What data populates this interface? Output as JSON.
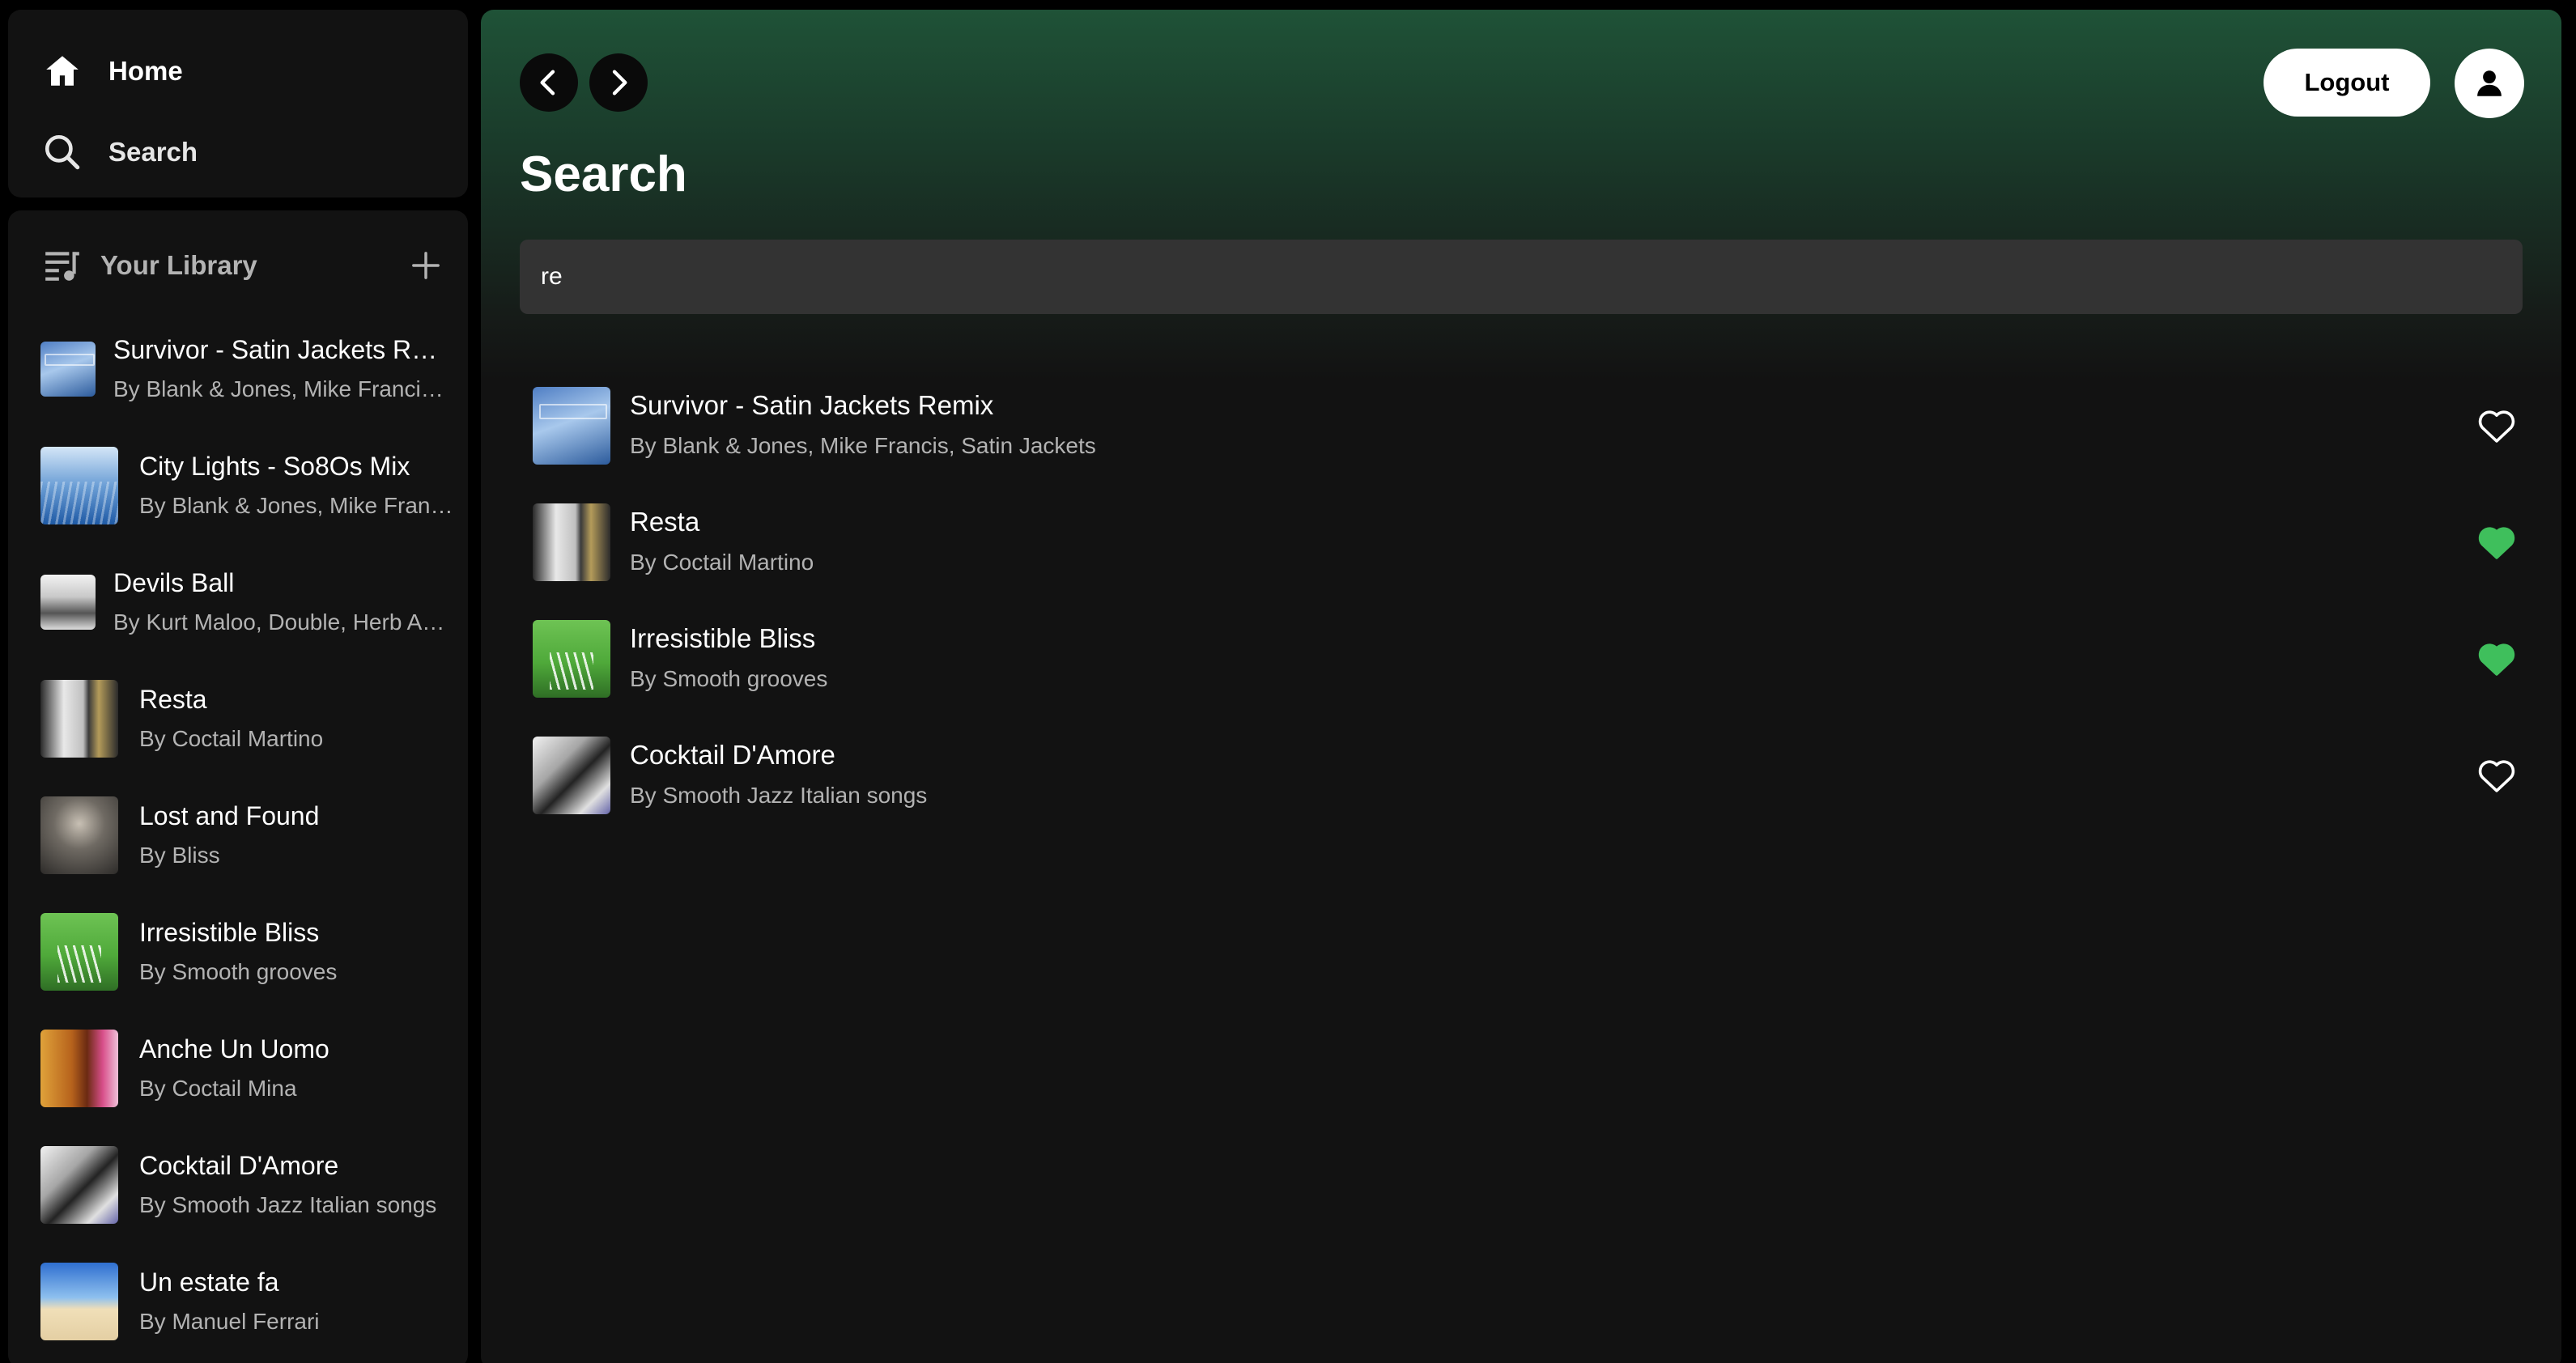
{
  "nav": {
    "home_label": "Home",
    "search_label": "Search"
  },
  "library": {
    "title": "Your Library",
    "items": [
      {
        "title": "Survivor - Satin Jackets Remix",
        "subtitle": "By Blank & Jones, Mike Francis, Satin Jackets",
        "cover": "blue-sea-art"
      },
      {
        "title": "City Lights - So8Os Mix",
        "subtitle": "By Blank & Jones, Mike Francis",
        "cover": "ice-blue-art"
      },
      {
        "title": "Devils Ball",
        "subtitle": "By Kurt Maloo, Double, Herb Alpert",
        "cover": "bw-car-art"
      },
      {
        "title": "Resta",
        "subtitle": "By Coctail Martino",
        "cover": "resta-art"
      },
      {
        "title": "Lost and Found",
        "subtitle": "By Bliss",
        "cover": "portrait-art"
      },
      {
        "title": "Irresistible Bliss",
        "subtitle": "By Smooth grooves",
        "cover": "green-smooth-art"
      },
      {
        "title": "Anche Un Uomo",
        "subtitle": "By Coctail Mina",
        "cover": "mina-art"
      },
      {
        "title": "Cocktail D'Amore",
        "subtitle": "By Smooth Jazz Italian songs",
        "cover": "amore-art"
      },
      {
        "title": "Un estate fa",
        "subtitle": "By Manuel Ferrari",
        "cover": "beach-art"
      }
    ]
  },
  "header": {
    "logout_label": "Logout",
    "page_title": "Search"
  },
  "search": {
    "value": "re",
    "placeholder": ""
  },
  "results": [
    {
      "title": "Survivor - Satin Jackets Remix",
      "subtitle": "By Blank & Jones, Mike Francis, Satin Jackets",
      "liked": false
    },
    {
      "title": "Resta",
      "subtitle": "By Coctail Martino",
      "liked": true
    },
    {
      "title": "Irresistible Bliss",
      "subtitle": "By Smooth grooves",
      "liked": true
    },
    {
      "title": "Cocktail D'Amore",
      "subtitle": "By Smooth Jazz Italian songs",
      "liked": false
    }
  ],
  "colors": {
    "accent_green": "#3fbf5c",
    "background": "#121212",
    "header_gradient_top": "#1f5237"
  }
}
